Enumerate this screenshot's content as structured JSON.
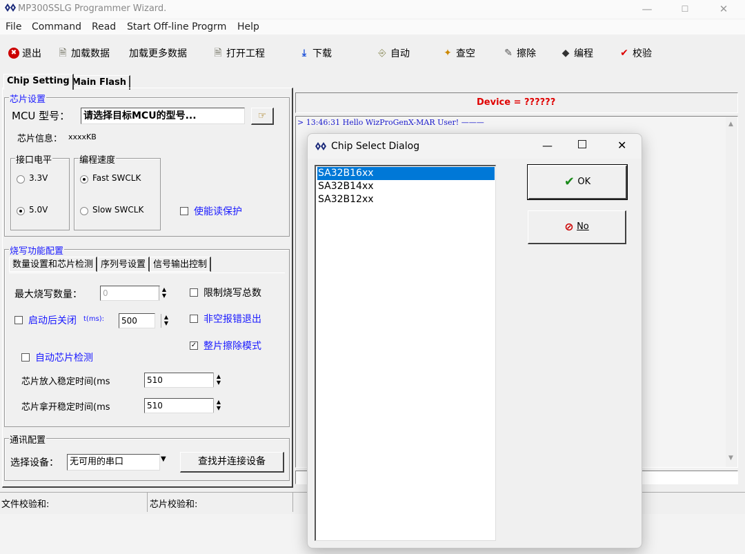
{
  "app": {
    "title": "MP300SSLG Programmer Wizard.",
    "min": "—",
    "max": "☐",
    "close": "✕"
  },
  "menu": [
    "File",
    "Command",
    "Read",
    "Start Off-line Progrm",
    "Help"
  ],
  "toolbar": {
    "exit": "退出",
    "load_data": "加载数据",
    "load_more": "加载更多数据",
    "open_project": "打开工程",
    "download": "下载",
    "auto": "自动",
    "check_empty": "查空",
    "erase": "擦除",
    "program": "编程",
    "verify": "校验"
  },
  "tabs": {
    "chip_setting": "Chip Setting",
    "main_flash": "Main Flash"
  },
  "chip": {
    "group": "芯片设置",
    "mcu_label": "MCU 型号：",
    "mcu_value": "请选择目标MCU的型号...",
    "info_label": "芯片信息：",
    "info_value": "xxxxKB",
    "voltage_group": "接口电平",
    "v33": "3.3V",
    "v50": "5.0V",
    "speed_group": "编程速度",
    "fast": "Fast SWCLK",
    "slow": "Slow SWCLK",
    "read_protect": "使能读保护"
  },
  "burn": {
    "group": "烧写功能配置",
    "subtabs": [
      "数量设置和芯片检测",
      "序列号设置",
      "信号输出控制"
    ],
    "max_count_label": "最大烧写数量：",
    "max_count_value": "0",
    "limit_total": "限制烧写总数",
    "auto_close_label": "启动后关闭",
    "auto_close_unit": "t(ms):",
    "auto_close_value": "500",
    "nonempty_exit": "非空报错退出",
    "full_erase": "整片擦除模式",
    "auto_detect": "自动芯片检测",
    "place_label": "芯片放入稳定时间(ms",
    "place_value": "510",
    "remove_label": "芯片拿开稳定时间(ms",
    "remove_value": "510"
  },
  "comm": {
    "group": "通讯配置",
    "select_label": "选择设备：",
    "select_value": "无可用的串口",
    "find_button": "查找并连接设备"
  },
  "device": {
    "text": "Device = ??????"
  },
  "log": {
    "line": "> 13:46:31 Hello WizProGenX-MAR User! ———"
  },
  "status": {
    "file_checksum": "文件校验和:",
    "chip_checksum": "芯片校验和:"
  },
  "dialog": {
    "title": "Chip Select Dialog",
    "items": [
      "SA32B16xx",
      "SA32B14xx",
      "SA32B12xx"
    ],
    "selected_index": 0,
    "ok": "OK",
    "no": "No"
  },
  "colors": {
    "accent_red": "#e00000",
    "select_blue": "#0078d7",
    "label_blue": "#1a1aff",
    "check_green": "#1a8a1a"
  }
}
